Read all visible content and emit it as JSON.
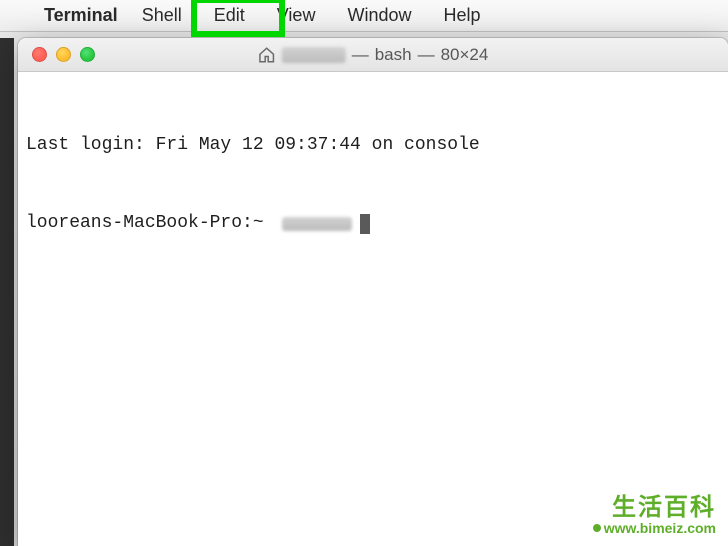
{
  "menubar": {
    "app_name": "Terminal",
    "items": [
      "Shell",
      "Edit",
      "View",
      "Window",
      "Help"
    ],
    "highlighted_index": 0
  },
  "window": {
    "title_sep1": "—",
    "title_process": "bash",
    "title_sep2": "—",
    "title_size": "80×24"
  },
  "terminal": {
    "line1": "Last login: Fri May 12 09:37:44 on console",
    "prompt": "looreans-MacBook-Pro:~ "
  },
  "watermark": {
    "text": "生活百科",
    "url": "www.bimeiz.com"
  }
}
